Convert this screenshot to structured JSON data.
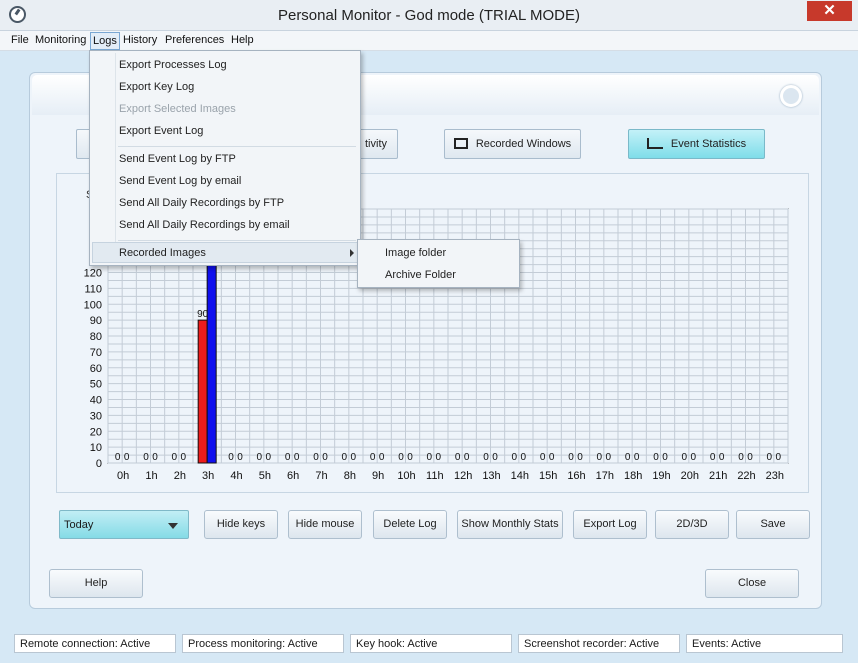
{
  "window": {
    "title": "Personal Monitor - God mode (TRIAL MODE)",
    "close_label": "✕"
  },
  "menubar": [
    "File",
    "Monitoring",
    "Logs",
    "History",
    "Preferences",
    "Help"
  ],
  "tabs": {
    "activity_partial": "tivity",
    "recorded_windows": "Recorded Windows",
    "event_statistics": "Event Statistics"
  },
  "logs_menu": {
    "items": [
      "Export Processes Log",
      "Export Key Log",
      "Export Selected Images",
      "Export Event Log",
      "Send Event Log by FTP",
      "Send Event Log by email",
      "Send All Daily Recordings by FTP",
      "Send All Daily Recordings by email",
      "Recorded Images"
    ],
    "disabled": [
      "Export Selected Images"
    ]
  },
  "submenu": {
    "items": [
      "Image folder",
      "Archive Folder"
    ]
  },
  "chart_data": {
    "type": "bar",
    "categories": [
      "0h",
      "1h",
      "2h",
      "3h",
      "4h",
      "5h",
      "6h",
      "7h",
      "8h",
      "9h",
      "10h",
      "11h",
      "12h",
      "13h",
      "14h",
      "15h",
      "16h",
      "17h",
      "18h",
      "19h",
      "20h",
      "21h",
      "22h",
      "23h"
    ],
    "series": [
      {
        "color": "#ee1c1c",
        "values": [
          0,
          0,
          0,
          90,
          0,
          0,
          0,
          0,
          0,
          0,
          0,
          0,
          0,
          0,
          0,
          0,
          0,
          0,
          0,
          0,
          0,
          0,
          0,
          0
        ]
      },
      {
        "color": "#1010ee",
        "values": [
          0,
          0,
          0,
          180,
          0,
          0,
          0,
          0,
          0,
          0,
          0,
          0,
          0,
          0,
          0,
          0,
          0,
          0,
          0,
          0,
          0,
          0,
          0,
          0
        ]
      }
    ],
    "ylim": [
      0,
      160
    ],
    "yticks": [
      0,
      10,
      20,
      30,
      40,
      50,
      60,
      70,
      80,
      90,
      100,
      110,
      120
    ],
    "grid": true,
    "title_partial": "S",
    "visible_value_labels": [
      "0",
      "0",
      "0",
      "0",
      "0",
      "0",
      "90",
      "0",
      "0",
      "0",
      "0",
      "0",
      "0",
      "0",
      "0",
      "0",
      "0",
      "0",
      "0",
      "0",
      "0",
      "0",
      "0",
      "0",
      "0",
      "0",
      "0",
      "0",
      "0",
      "0",
      "0",
      "0",
      "0",
      "0",
      "0",
      "0",
      "0",
      "0",
      "0",
      "0",
      "0",
      "0",
      "0",
      "0",
      "0",
      "0",
      "0"
    ]
  },
  "controls": {
    "period": "Today",
    "buttons": [
      "Hide keys",
      "Hide mouse",
      "Delete Log",
      "Show Monthly Stats",
      "Export Log",
      "2D/3D",
      "Save"
    ],
    "help": "Help",
    "close": "Close"
  },
  "status": [
    "Remote connection: Active",
    "Process monitoring: Active",
    "Key hook: Active",
    "Screenshot recorder: Active",
    "Events: Active"
  ]
}
